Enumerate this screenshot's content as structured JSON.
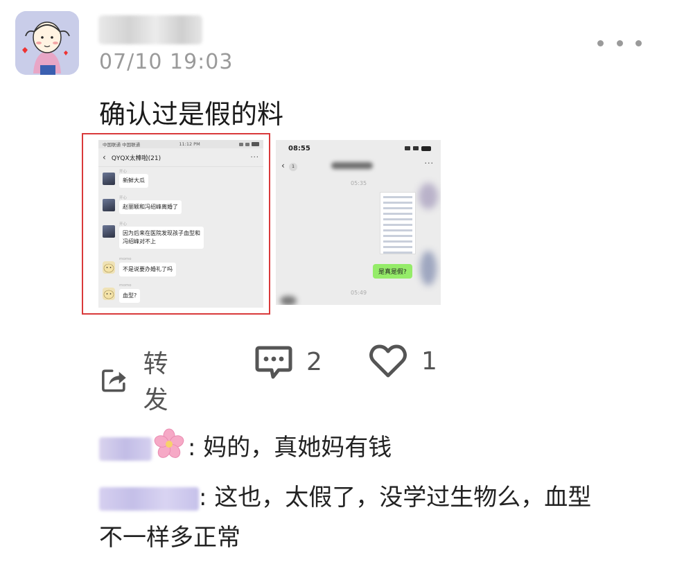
{
  "post": {
    "timestamp": "07/10 19:03",
    "text": "确认过是假的料"
  },
  "thumbnail_1": {
    "status_left": "中国联通 中国联通",
    "status_time": "11:12 PM",
    "chat_title": "QYQX太棒啦(21)",
    "messages": [
      {
        "name": "开心",
        "text": "新鲜大瓜"
      },
      {
        "name": "开心",
        "text": "赵丽颖和冯绍峰离婚了"
      },
      {
        "name": "开心",
        "text": "因为后来在医院发现孩子血型和",
        "text2": "冯绍峰对不上"
      },
      {
        "name": "momo",
        "text": "不是说要办婚礼了吗"
      },
      {
        "name": "momo",
        "text": "血型?"
      }
    ]
  },
  "thumbnail_2": {
    "status_time": "08:55",
    "back_count": "1",
    "time1": "05:35",
    "time2": "05:49",
    "green_bubble": "是真是假?"
  },
  "actions": {
    "share_label": "转发",
    "comment_count": "2",
    "like_count": "1"
  },
  "comments": [
    {
      "text": ": 妈的，真她妈有钱"
    },
    {
      "text": ": 这也，太假了，没学过生物么，血型",
      "text2": "不一样多正常"
    }
  ],
  "icons": {
    "share": "share-icon",
    "comment": "comment-icon",
    "like": "heart-icon",
    "more": "more-icon",
    "flower": "cherry-blossom-icon"
  }
}
